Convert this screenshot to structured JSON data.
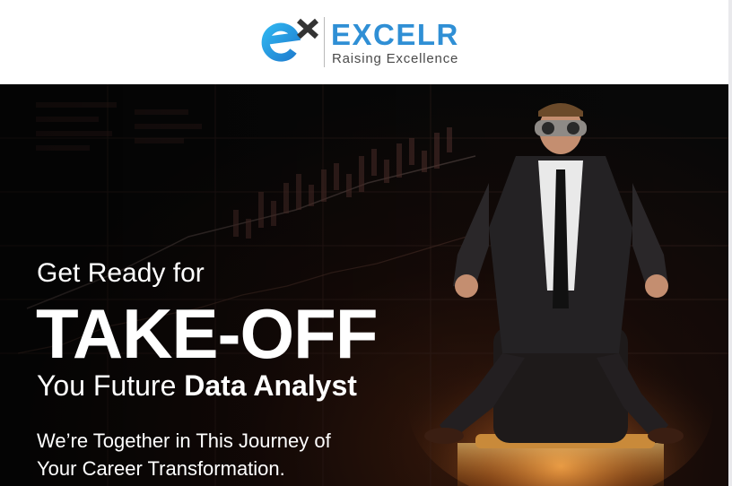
{
  "brand": {
    "name": "EXCELR",
    "tagline": "Raising Excellence",
    "colors": {
      "blue": "#2f8fd5",
      "dark": "#3a3a3a"
    },
    "logo_icon": "excelr-ex-logo-icon"
  },
  "hero": {
    "line1": "Get Ready for",
    "headline": "TAKE-OFF",
    "line3_prefix": "You Future",
    "line3_emphasis": "Data Analyst",
    "body_line1": "We’re Together in This Journey of",
    "body_line2": "Your Career Transformation.",
    "image": "businessman-with-goggles-on-rocket-chair",
    "background": "stock-market-chart"
  }
}
